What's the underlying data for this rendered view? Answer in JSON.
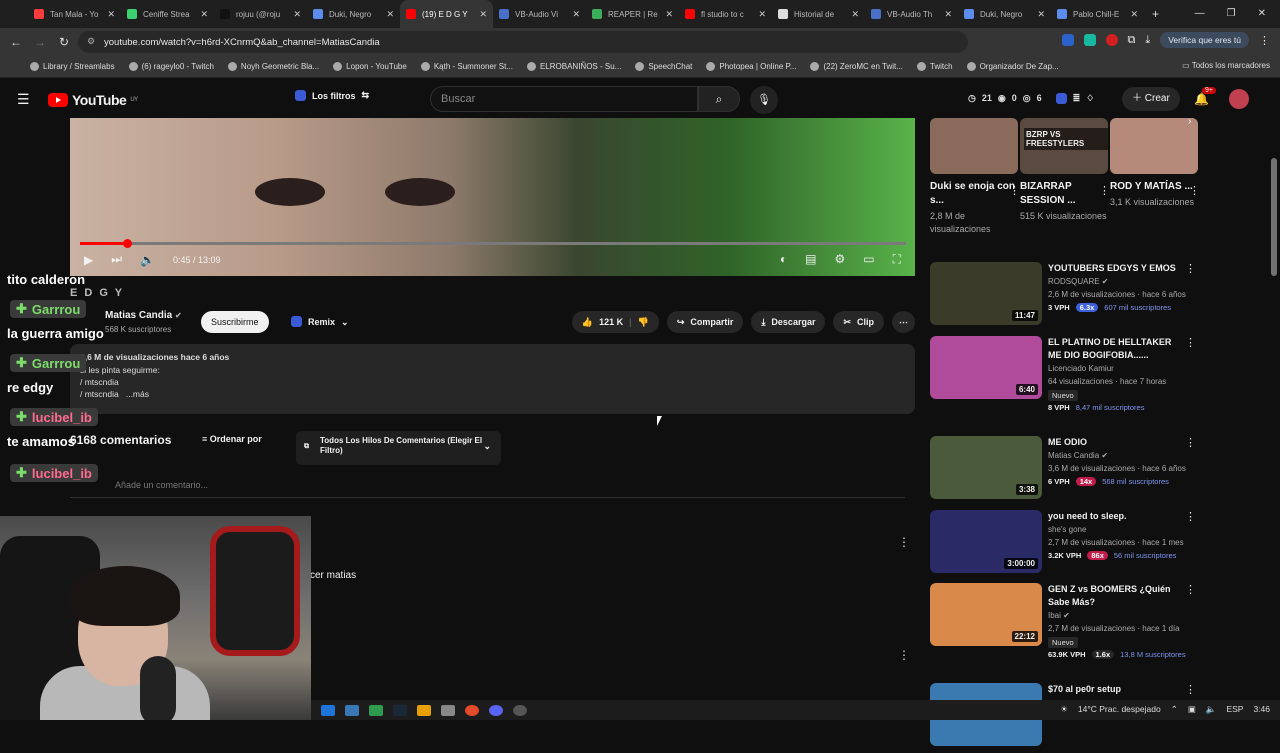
{
  "browser": {
    "tabs": [
      {
        "title": "Tan Mala - Yo",
        "color": "#ff3b3b"
      },
      {
        "title": "Ceniffe Strea",
        "color": "#3bd16f"
      },
      {
        "title": "rojuu (@roju",
        "color": "#111111"
      },
      {
        "title": "Duki, Negro",
        "color": "#5b8def"
      },
      {
        "title": "(19) E D G Y",
        "color": "#ff0000",
        "active": true
      },
      {
        "title": "VB-Audio Vi",
        "color": "#4a6fc8"
      },
      {
        "title": "REAPER | Re",
        "color": "#3cae5a"
      },
      {
        "title": "fl studio to c",
        "color": "#ff0000"
      },
      {
        "title": "Historial de",
        "color": "#dddddd"
      },
      {
        "title": "VB-Audio Th",
        "color": "#4a6fc8"
      },
      {
        "title": "Duki, Negro",
        "color": "#5b8def"
      },
      {
        "title": "Pablo Chill-E",
        "color": "#5b8def"
      }
    ],
    "url": "youtube.com/watch?v=h6rd-XCnrmQ&ab_channel=MatiasCandia",
    "verify_label": "Verifica que eres tú",
    "bookmarks": [
      "Library / Streamlabs",
      "(6) rageylo0 - Twitch",
      "Noyh Geometric Bla...",
      "Lopon - YouTube",
      "Kąth - Summoner St...",
      "ELROBANIÑOS - Su...",
      "SpeechChat",
      "Photopea | Online P...",
      "(22) ZeroMC en Twit...",
      "Twitch",
      "Organizador De Zap..."
    ],
    "all_bookmarks": "Todos los marcadores"
  },
  "header": {
    "logo": "YouTube",
    "region": "UY",
    "filters_label": "Los filtros",
    "search_placeholder": "Buscar",
    "stat1": "21",
    "stat2": "0",
    "stat3": "6",
    "create_label": "Crear",
    "notif_badge": "9+"
  },
  "player": {
    "time": "0:45 / 13:09",
    "progress": 0.057,
    "title_overlay": "E D G Y"
  },
  "video": {
    "channel": "Matias Candia",
    "subscribers": "568 K suscriptores",
    "subscribe_label": "Suscribirme",
    "remix_label": "Remix",
    "likes": "121 K",
    "share_label": "Compartir",
    "download_label": "Descargar",
    "clip_label": "Clip"
  },
  "description": {
    "views_line": "3,6 M de visualizaciones  hace 6 años",
    "line2": "si les pinta seguirme:",
    "line3": "/ mtscndia",
    "line4": "/ mtscndia",
    "more": "...más"
  },
  "comments": {
    "count": "6168 comentarios",
    "sort_label": "Ordenar por",
    "filter_label": "Todos Los Hilos De Comentarios (Elegir El Filtro)",
    "add_placeholder": "Añade un comentario...",
    "visible_text": "cer matias"
  },
  "chat": [
    {
      "type": "msg",
      "text": "tito calderon"
    },
    {
      "type": "user",
      "name": "Garrrou",
      "color": "#7cdc6a"
    },
    {
      "type": "msg",
      "text": "la guerra amigo"
    },
    {
      "type": "user",
      "name": "Garrrou",
      "color": "#7cdc6a"
    },
    {
      "type": "msg",
      "text": "re edgy"
    },
    {
      "type": "user",
      "name": "lucibel_ib",
      "color": "#ff6b8f"
    },
    {
      "type": "msg",
      "text": "te amamos"
    },
    {
      "type": "user",
      "name": "lucibel_ib",
      "color": "#ff6b8f"
    }
  ],
  "shorts": [
    {
      "title": "Duki se enoja con s...",
      "views": "2,8 M de visualizaciones",
      "color": "#8a6a5a"
    },
    {
      "title": "BIZARRAP SESSION ...",
      "views": "515 K visualizaciones",
      "overlay": "BZRP VS FREESTYLERS",
      "color": "#5a4a40"
    },
    {
      "title": "ROD Y MATÍAS ...",
      "views": "3,1 K visualizaciones",
      "color": "#b58a7a"
    }
  ],
  "recommendations": [
    {
      "title": "YOUTUBERS EDGYS Y EMOS",
      "channel": "RODSQUARE",
      "verified": true,
      "meta": "2,6 M de visualizaciones · hace 6 años",
      "vph": "3 VPH",
      "mult": "6.3x",
      "mult_color": "blue",
      "subs": "607 mil suscriptores",
      "duration": "11:47",
      "thumb": "#3b3b2a"
    },
    {
      "title": "EL PLATINO DE HELLTAKER ME DIO BOGIFOBIA......",
      "channel": "Licenciado Kamiur",
      "verified": false,
      "meta": "64 visualizaciones · hace 7 horas",
      "nuevo": "Nuevo",
      "vph": "8 VPH",
      "mult": "",
      "subs": "8,47 mil suscriptores",
      "duration": "6:40",
      "thumb": "#b04a9a"
    },
    {
      "title": "ME ODIO",
      "channel": "Matias Candia",
      "verified": true,
      "meta": "3,6 M de visualizaciones · hace 6 años",
      "vph": "6 VPH",
      "mult": "14x",
      "mult_color": "red",
      "subs": "568 mil suscriptores",
      "duration": "3:38",
      "thumb": "#4a5a3a"
    },
    {
      "title": "you need to sleep.",
      "channel": "she's gone",
      "verified": false,
      "meta": "2,7 M de visualizaciones · hace 1 mes",
      "vph": "3.2K VPH",
      "mult": "86x",
      "mult_color": "red",
      "subs": "56 mil suscriptores",
      "duration": "3:00:00",
      "thumb": "#2a2a66"
    },
    {
      "title": "GEN Z vs BOOMERS ¿Quién Sabe Más?",
      "channel": "Ibai",
      "verified": true,
      "meta": "2,7 M de visualizaciones · hace 1 día",
      "nuevo": "Nuevo",
      "vph": "63.9K VPH",
      "mult": "1.6x",
      "mult_color": "plain",
      "subs": "13,8 M suscriptores",
      "duration": "22:12",
      "thumb": "#d98a4a"
    },
    {
      "title": "$70 al pe0r setup",
      "channel": "",
      "meta": "",
      "vph": "",
      "duration": "",
      "thumb": "#3a7ab0"
    }
  ],
  "taskbar": {
    "weather": "14°C  Prac. despejado",
    "lang": "ESP",
    "clock": "3:46"
  }
}
